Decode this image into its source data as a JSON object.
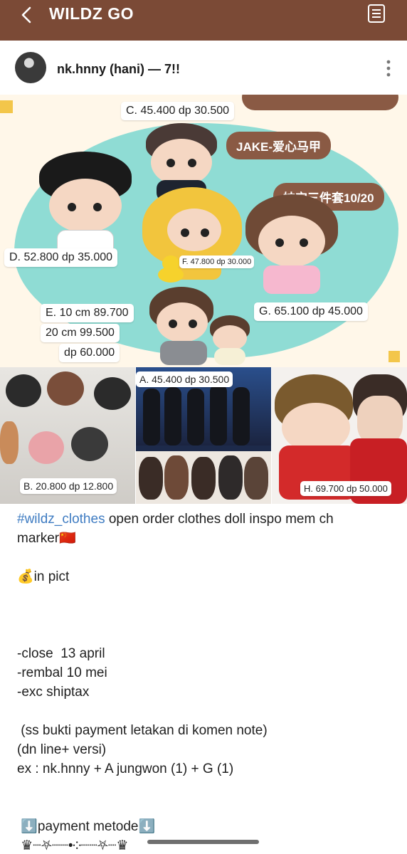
{
  "app": {
    "title": "WILDZ GO",
    "back_icon": "chevron-left-icon",
    "menu_icon": "document-list-icon",
    "bar_color": "#7b4a36"
  },
  "author": {
    "name": "nk.hnny (hani) — 7!!",
    "more_icon": "vertical-ellipsis-icon"
  },
  "banner": {
    "ribbons": [
      "JAKE-爱心马甲",
      "妹宝三件套10/20"
    ],
    "labels": {
      "c": "C. 45.400 dp 30.500",
      "d": "D. 52.800 dp 35.000",
      "f": "F. 47.800 dp 30.000",
      "e1": "E. 10 cm 89.700",
      "e2": "20 cm 99.500",
      "e3": "dp 60.000",
      "g": "G. 65.100 dp 45.000"
    },
    "accent": "#8a5a44",
    "bg": "#8fdcd4"
  },
  "tiles": {
    "b": "B. 20.800 dp 12.800",
    "a": "A. 45.400 dp 30.500",
    "h": "H. 69.700 dp 50.000"
  },
  "caption": {
    "hashtag": "#wildz_clothes",
    "line1_rest": " open order clothes doll inspo mem ch",
    "line2": "marker🇨🇳",
    "line3": "💰in pict",
    "line4": "-close  13 april",
    "line5": "-rembal 10 mei",
    "line6": "-exc shiptax",
    "line7": " (ss bukti payment letakan di komen note)",
    "line8": "(dn line+ versi)",
    "line9": "ex : nk.hnny + A jungwon (1) + G (1)",
    "line10": " ⬇️payment metode⬇️",
    "line11": " ♛┈⛧┈┈•༶┈┈⛧┈♛"
  }
}
